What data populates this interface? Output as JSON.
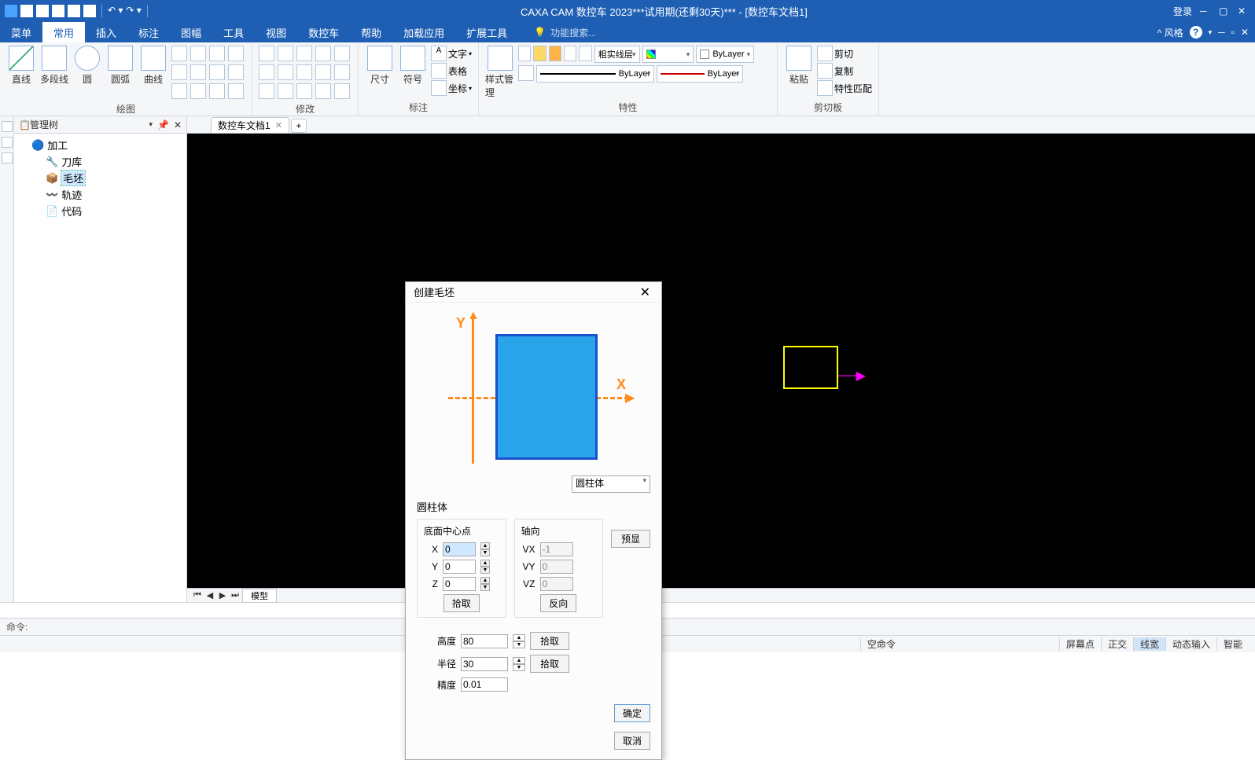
{
  "title": "CAXA CAM 数控车 2023***试用期(还剩30天)*** - [数控车文档1]",
  "login": "登录",
  "style_label": "^ 风格",
  "tabs": [
    "菜单",
    "常用",
    "插入",
    "标注",
    "图幅",
    "工具",
    "视图",
    "数控车",
    "帮助",
    "加载应用",
    "扩展工具"
  ],
  "active_tab_index": 1,
  "search_placeholder": "功能搜索...",
  "ribbon_groups": {
    "draw": {
      "label": "绘图",
      "buttons": [
        "直线",
        "多段线",
        "圆",
        "圆弧",
        "曲线"
      ]
    },
    "modify": {
      "label": "修改"
    },
    "annotate": {
      "label": "标注",
      "dimension": "尺寸",
      "symbol": "符号",
      "text": "文字",
      "table": "表格",
      "coord": "坐标"
    },
    "style": {
      "label": "特性",
      "style_manage": "样式管理",
      "linetype": "粗实线层",
      "bylayer1": "ByLayer",
      "bylayer2": "ByLayer",
      "bylayer3": "ByLayer"
    },
    "clipboard": {
      "label": "剪切板",
      "paste": "粘贴",
      "cut": "剪切",
      "copy": "复制",
      "match": "特性匹配"
    }
  },
  "tree": {
    "title": "管理树",
    "root": "加工",
    "nodes": [
      {
        "label": "刀库",
        "icon": "tool-icon"
      },
      {
        "label": "毛坯",
        "icon": "blank-icon",
        "selected": true
      },
      {
        "label": "轨迹",
        "icon": "path-icon"
      },
      {
        "label": "代码",
        "icon": "code-icon"
      }
    ]
  },
  "doc_tab": "数控车文档1",
  "model_tab": "模型",
  "dialog": {
    "title": "创建毛坯",
    "shape_select": "圆柱体",
    "group_label": "圆柱体",
    "center_label": "底面中心点",
    "axis_label": "轴向",
    "x_label": "X",
    "x_val": "0",
    "y_label": "Y",
    "y_val": "0",
    "z_label": "Z",
    "z_val": "0",
    "vx_label": "VX",
    "vx_val": "-1",
    "vy_label": "VY",
    "vy_val": "0",
    "vz_label": "VZ",
    "vz_val": "0",
    "pick": "拾取",
    "reverse": "反向",
    "preview": "预显",
    "height_label": "高度",
    "height_val": "80",
    "radius_label": "半径",
    "radius_val": "30",
    "precision_label": "精度",
    "precision_val": "0.01",
    "ok": "确定",
    "cancel": "取消",
    "diagram_x": "X",
    "diagram_y": "Y"
  },
  "cmd_prompt": "命令:",
  "status": {
    "empty_cmd": "空命令",
    "screen_pt": "屏幕点",
    "ortho": "正交",
    "lineweight": "线宽",
    "dyn_input": "动态输入",
    "smart": "智能"
  }
}
